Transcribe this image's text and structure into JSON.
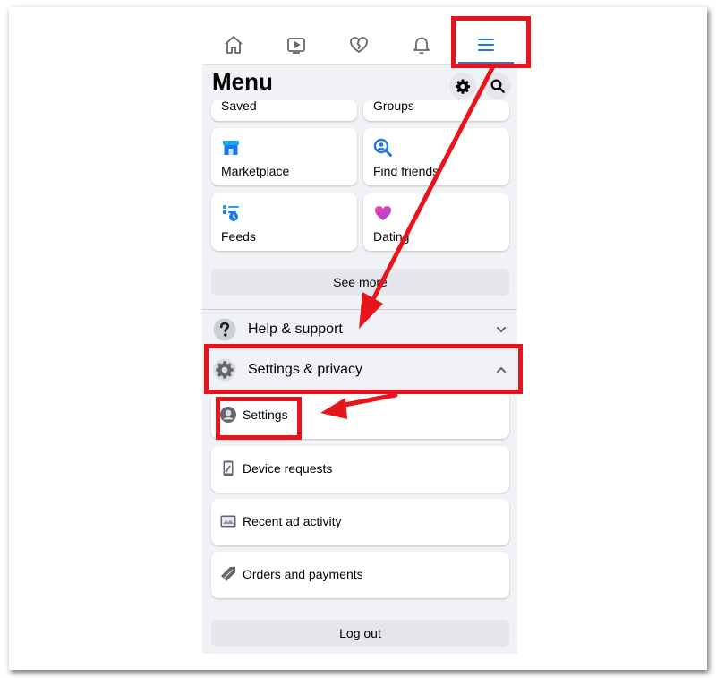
{
  "nav": {
    "tabs": [
      {
        "name": "home",
        "icon": "home-icon",
        "active": false
      },
      {
        "name": "watch",
        "icon": "video-icon",
        "active": false
      },
      {
        "name": "dating",
        "icon": "heart-icon",
        "active": false
      },
      {
        "name": "notifications",
        "icon": "bell-icon",
        "active": false
      },
      {
        "name": "menu",
        "icon": "hamburger-menu-icon",
        "active": true
      }
    ],
    "accent": "#1877f2"
  },
  "header": {
    "title": "Menu",
    "settings_icon": "gear-icon",
    "search_icon": "search-icon"
  },
  "shortcuts": [
    {
      "label": "Saved",
      "icon": "bookmark-icon"
    },
    {
      "label": "Groups",
      "icon": "groups-icon"
    },
    {
      "label": "Marketplace",
      "icon": "marketplace-icon"
    },
    {
      "label": "Find friends",
      "icon": "find-friends-icon"
    },
    {
      "label": "Feeds",
      "icon": "feeds-icon"
    },
    {
      "label": "Dating",
      "icon": "dating-heart-icon"
    }
  ],
  "see_more_label": "See more",
  "sections": {
    "help": {
      "title": "Help & support",
      "icon": "question-icon",
      "expanded": false
    },
    "settings_privacy": {
      "title": "Settings & privacy",
      "icon": "gear-icon",
      "expanded": true
    }
  },
  "settings_items": [
    {
      "label": "Settings",
      "icon": "person-circle-icon"
    },
    {
      "label": "Device requests",
      "icon": "phone-icon"
    },
    {
      "label": "Recent ad activity",
      "icon": "ad-activity-icon"
    },
    {
      "label": "Orders and payments",
      "icon": "tag-icon"
    }
  ],
  "logout_label": "Log out",
  "annotation_color": "#e8141b"
}
